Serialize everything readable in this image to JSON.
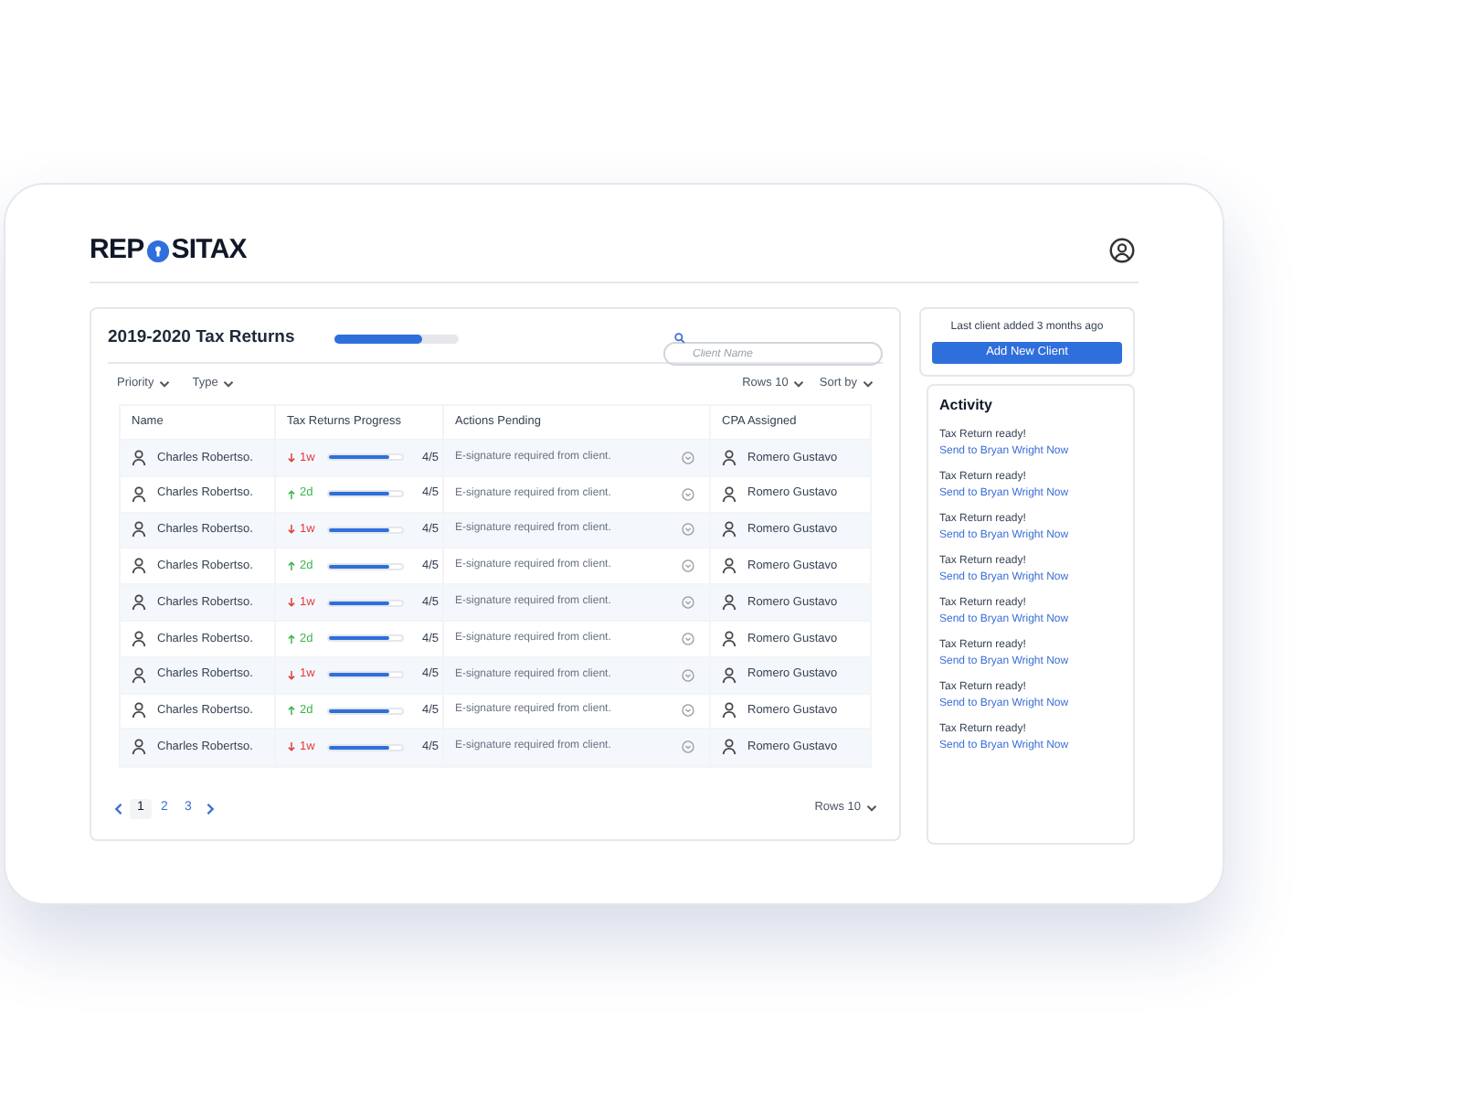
{
  "header": {
    "logo_start": "REP",
    "logo_end": "SITAX"
  },
  "returns": {
    "title": "2019-2020 Tax Returns",
    "level": 0.7,
    "search": {
      "placeholder": "Client Name"
    },
    "filters": [
      "Priority",
      "Type"
    ],
    "controls": [
      "Rows 10",
      "Sort by"
    ],
    "table": {
      "columns": [
        "Name",
        "Tax Returns Progress",
        "Actions Pending",
        "CPA Assigned"
      ],
      "rows": [
        {
          "name": "Charles Robertso.",
          "kind": "down",
          "delta": "1w",
          "level": 0.82,
          "count": "4/5",
          "action": "E-signature required from client.",
          "cpa": "Romero Gustavo"
        },
        {
          "name": "Charles Robertso.",
          "kind": "up",
          "delta": "2d",
          "level": 0.82,
          "count": "4/5",
          "action": "E-signature required from client.",
          "cpa": "Romero Gustavo"
        },
        {
          "name": "Charles Robertso.",
          "kind": "down",
          "delta": "1w",
          "level": 0.82,
          "count": "4/5",
          "action": "E-signature required from client.",
          "cpa": "Romero Gustavo"
        },
        {
          "name": "Charles Robertso.",
          "kind": "up",
          "delta": "2d",
          "level": 0.82,
          "count": "4/5",
          "action": "E-signature required from client.",
          "cpa": "Romero Gustavo"
        },
        {
          "name": "Charles Robertso.",
          "kind": "down",
          "delta": "1w",
          "level": 0.82,
          "count": "4/5",
          "action": "E-signature required from client.",
          "cpa": "Romero Gustavo"
        },
        {
          "name": "Charles Robertso.",
          "kind": "up",
          "delta": "2d",
          "level": 0.82,
          "count": "4/5",
          "action": "E-signature required from client.",
          "cpa": "Romero Gustavo"
        },
        {
          "name": "Charles Robertso.",
          "kind": "down",
          "delta": "1w",
          "level": 0.82,
          "count": "4/5",
          "action": "E-signature required from client.",
          "cpa": "Romero Gustavo"
        },
        {
          "name": "Charles Robertso.",
          "kind": "up",
          "delta": "2d",
          "level": 0.82,
          "count": "4/5",
          "action": "E-signature required from client.",
          "cpa": "Romero Gustavo"
        },
        {
          "name": "Charles Robertso.",
          "kind": "down",
          "delta": "1w",
          "level": 0.82,
          "count": "4/5",
          "action": "E-signature required from client.",
          "cpa": "Romero Gustavo"
        }
      ]
    },
    "pagination": {
      "pages": [
        {
          "label": "1",
          "selected": true
        },
        {
          "label": "2",
          "selected": false
        },
        {
          "label": "3",
          "selected": false
        }
      ],
      "rows": "Rows 10"
    }
  },
  "summary": {
    "text": "Last client added 3 months ago",
    "button": "Add New Client"
  },
  "activity": {
    "title": "Activity",
    "items": [
      {
        "text": "Tax Return ready!",
        "link": "Send to Bryan Wright Now"
      },
      {
        "text": "Tax Return ready!",
        "link": "Send to Bryan Wright Now"
      },
      {
        "text": "Tax Return ready!",
        "link": "Send to Bryan Wright Now"
      },
      {
        "text": "Tax Return ready!",
        "link": "Send to Bryan Wright Now"
      },
      {
        "text": "Tax Return ready!",
        "link": "Send to Bryan Wright Now"
      },
      {
        "text": "Tax Return ready!",
        "link": "Send to Bryan Wright Now"
      },
      {
        "text": "Tax Return ready!",
        "link": "Send to Bryan Wright Now"
      },
      {
        "text": "Tax Return ready!",
        "link": "Send to Bryan Wright Now"
      }
    ]
  }
}
